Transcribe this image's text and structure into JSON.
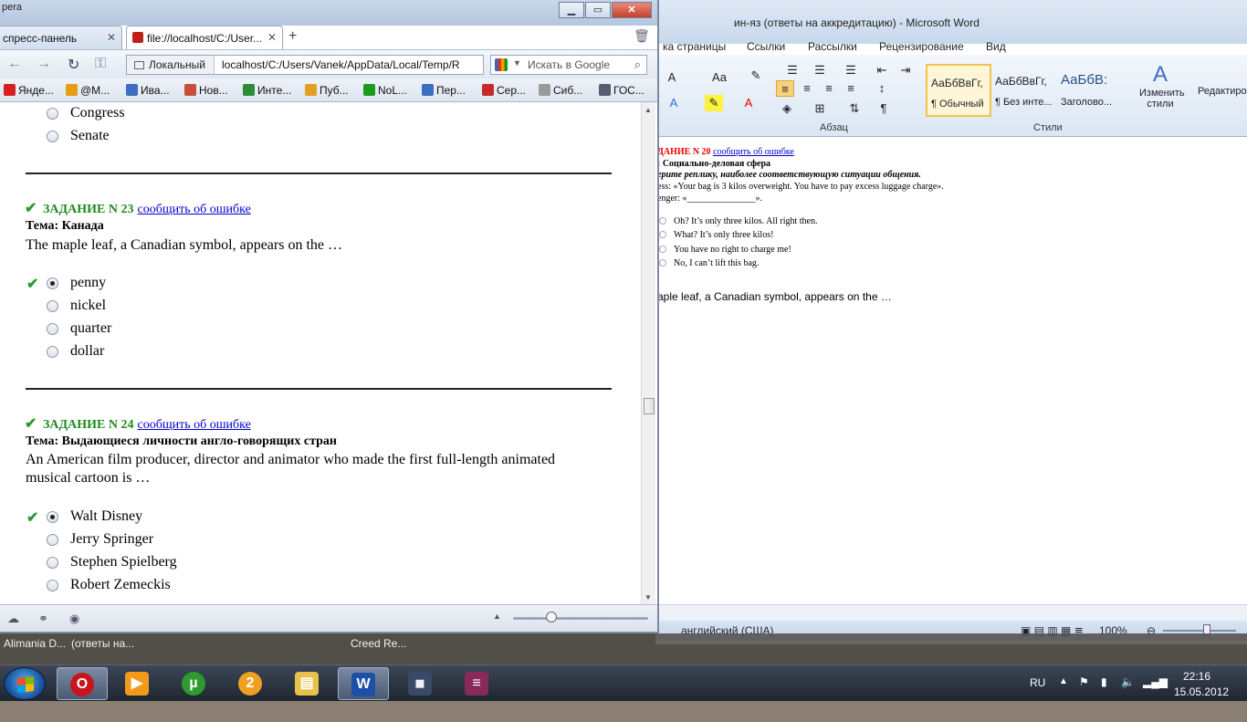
{
  "word": {
    "title": "ин-яз (ответы на аккредитацию)  -  Microsoft Word",
    "tabs": [
      "ка страницы",
      "Ссылки",
      "Рассылки",
      "Рецензирование",
      "Вид"
    ],
    "groups": {
      "paragraph": "Абзац",
      "styles": "Стили"
    },
    "styles": [
      {
        "sample": "АаБбВвГг,",
        "name": "¶ Обычный"
      },
      {
        "sample": "АаБбВвГг,",
        "name": "¶ Без инте..."
      },
      {
        "sample": "АаБбВ:",
        "name": "Заголово..."
      }
    ],
    "change_styles": "Изменить стили",
    "editing": "Редактиров",
    "doc": {
      "task": "ДАНИЕ N 20",
      "report": "сообщить об ошибке",
      "topic": ": Социально-деловая сфера",
      "instr": "ерите реплику, наиболее соответствующую ситуации общения.",
      "line1": "ess: «Your bag is 3 kilos overweight. You have to pay excess luggage charge».",
      "line2": "enger: «_______________».",
      "options": [
        "Oh? It’s only three kilos. All right then.",
        "What? It’s only three kilos!",
        "You have no right to charge me!",
        "No, I can’t lift this bag."
      ],
      "line3": "aple leaf, a Canadian symbol, appears on the …"
    },
    "status": {
      "lang": "английский (США)",
      "zoom": "100%"
    }
  },
  "opera": {
    "app_name": "pera",
    "tabs": [
      {
        "label": "спресс-панель",
        "active": false
      },
      {
        "label": "file://localhost/C:/User...",
        "active": true
      }
    ],
    "address_zone": "Локальный",
    "url": "localhost/C:/Users/Vanek/AppData/Local/Temp/R",
    "search_placeholder": "Искать в Google",
    "bookmarks": [
      {
        "label": "Янде...",
        "color": "#d62020"
      },
      {
        "label": "@M...",
        "color": "#e89b14"
      },
      {
        "label": "Ива...",
        "color": "#3d6ec0"
      },
      {
        "label": "Нов...",
        "color": "#c64f3a"
      },
      {
        "label": "Инте...",
        "color": "#2e8b3a"
      },
      {
        "label": "Пуб...",
        "color": "#e0a020"
      },
      {
        "label": "NoL...",
        "color": "#1d9a1d"
      },
      {
        "label": "Пер...",
        "color": "#3a6fbf"
      },
      {
        "label": "Сер...",
        "color": "#c82a2a"
      },
      {
        "label": "Сиб...",
        "color": "#9a9a9a"
      },
      {
        "label": "ГОС...",
        "color": "#555f70"
      }
    ]
  },
  "page": {
    "prev_options": [
      "Congress",
      "Senate"
    ],
    "q23": {
      "task": "ЗАДАНИЕ N 23",
      "report": "сообщить об ошибке",
      "topic": "Тема: Канада",
      "question": "The maple leaf, a Canadian symbol, appears on the …",
      "options": [
        "penny",
        "nickel",
        "quarter",
        "dollar"
      ]
    },
    "q24": {
      "task": "ЗАДАНИЕ N 24",
      "report": "сообщить об ошибке",
      "topic": "Тема: Выдающиеся личности англо-говорящих стран",
      "question": "An American film producer, director and animator who made the first full-length animated musical cartoon is …",
      "options": [
        "Walt Disney",
        "Jerry Springer",
        "Stephen Spielberg",
        "Robert Zemeckis"
      ]
    }
  },
  "taskstrip": [
    "Alimania D...",
    "(ответы на...",
    "Creed Re..."
  ],
  "taskbar": {
    "lang": "RU",
    "time": "22:16",
    "date": "15.05.2012"
  }
}
